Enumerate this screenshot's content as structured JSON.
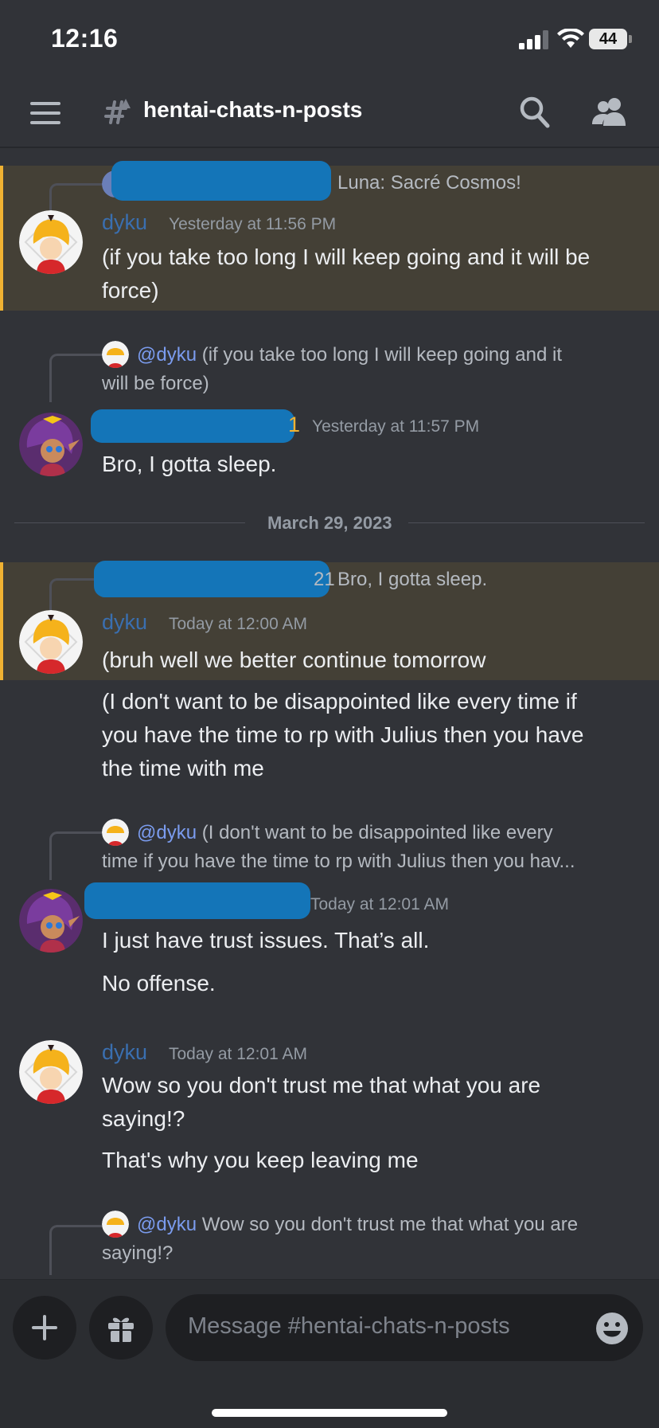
{
  "status_bar": {
    "time": "12:16",
    "battery": "44"
  },
  "header": {
    "channel": "hentai-chats-n-posts"
  },
  "date_divider": "March 29, 2023",
  "messages": [
    {
      "reply": {
        "preview": "Luna: Sacré Cosmos!"
      },
      "user": "dyku",
      "time": "Yesterday at 11:56 PM",
      "lines": [
        "(if you take too long I will keep going and it will be",
        "force)"
      ]
    },
    {
      "reply": {
        "mention": "@dyku",
        "preview_l1": "(if you take too long I will keep going and it",
        "preview_l2": "will be force)"
      },
      "user_suffix": "1",
      "time": "Yesterday at 11:57 PM",
      "lines": [
        "Bro, I gotta sleep."
      ]
    },
    {
      "reply": {
        "suffix": "21",
        "preview": "Bro, I gotta sleep."
      },
      "user": "dyku",
      "time": "Today at 12:00 AM",
      "lines": [
        "(bruh well we better continue tomorrow"
      ]
    },
    {
      "lines": [
        "(I don't want to be disappointed like every time if",
        "you have the time to rp with Julius then you have",
        "the time with me"
      ]
    },
    {
      "reply": {
        "mention": "@dyku",
        "preview_l1": "(I don't want to be disappointed like every",
        "preview_l2": "time if you have the time to rp with Julius then you hav..."
      },
      "time": "Today at 12:01 AM",
      "lines": [
        "I just have trust issues. That’s all.",
        "No offense."
      ]
    },
    {
      "user": "dyku",
      "time": "Today at 12:01 AM",
      "lines": [
        "Wow so you don't trust me that what you are",
        "saying!?",
        "That's why you keep leaving me"
      ]
    },
    {
      "reply": {
        "mention": "@dyku",
        "preview_l1": "Wow so you don't trust me that what you are",
        "preview_l2": "saying!?"
      }
    }
  ],
  "composer": {
    "placeholder": "Message #hentai-chats-n-posts"
  },
  "colors": {
    "background": "#313338",
    "mention_highlight": "#444036",
    "mention_bar": "#f0b232",
    "dyku_name": "#3a6fb0",
    "link": "#7b9cef"
  },
  "icons": [
    "menu-icon",
    "channel-hash-icon",
    "search-icon",
    "members-icon",
    "plus-icon",
    "gift-icon",
    "emoji-icon"
  ]
}
